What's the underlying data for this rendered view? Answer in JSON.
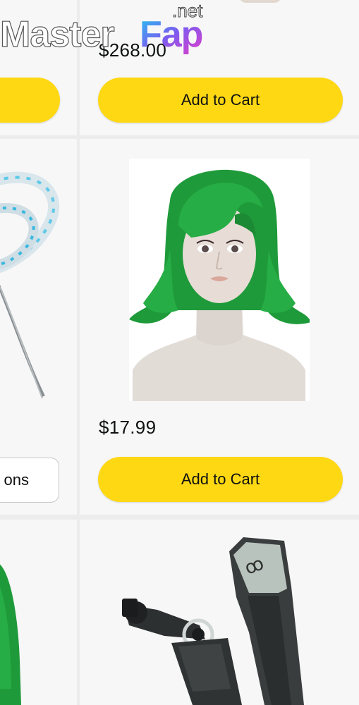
{
  "products": {
    "top_right": {
      "price": "$268.00",
      "cart_label": "Add to Cart"
    },
    "top_left": {
      "cart_label": ""
    },
    "mid_left": {
      "options_label": "ons"
    },
    "mid_right": {
      "image": "green-bob-wig-on-mannequin",
      "price": "$17.99",
      "cart_label": "Add to Cart"
    },
    "bottom_left": {
      "image": "green-wig-partial"
    },
    "bottom_right": {
      "image": "action-camera-mount"
    }
  },
  "watermark": {
    "line1": ".net",
    "line2": "MasterFap"
  },
  "colors": {
    "cart_button": "#ffd814",
    "card_bg": "#f7f7f7",
    "gutter": "#ececec",
    "wig_green": "#1f9a3a"
  }
}
